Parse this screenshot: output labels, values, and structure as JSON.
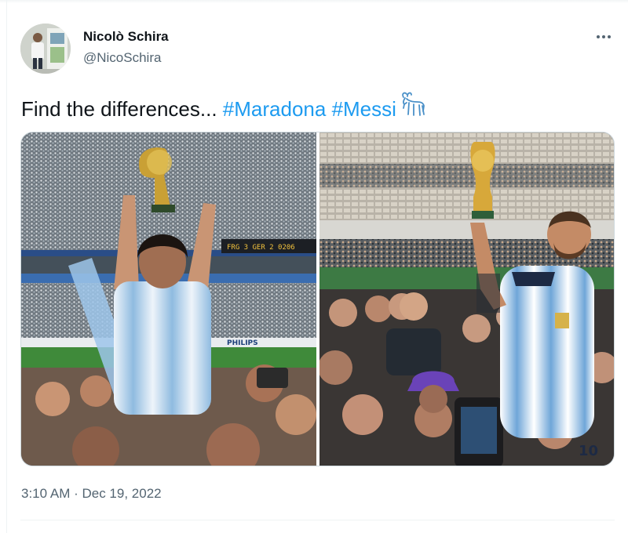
{
  "author": {
    "name": "Nicolò Schira",
    "handle": "@NicoSchira",
    "avatar_icon": "profile-photo"
  },
  "tweet": {
    "text_prefix": "Find the differences... ",
    "hashtags": [
      "#Maradona",
      "#Messi"
    ],
    "emoji": "goat-emoji"
  },
  "media": {
    "images": [
      {
        "name": "maradona-trophy-photo",
        "scoreboard_text": "FRG 3 GER 2 0206"
      },
      {
        "name": "messi-trophy-photo",
        "jersey_number": "10"
      }
    ]
  },
  "meta": {
    "timestamp": "3:10 AM · Dec 19, 2022"
  },
  "colors": {
    "text": "#0f1419",
    "secondary": "#536471",
    "link": "#1d9bf0",
    "border": "#cfd9de",
    "albiceleste": "#75aadb"
  },
  "icons": {
    "more": "more-horizontal-icon"
  }
}
